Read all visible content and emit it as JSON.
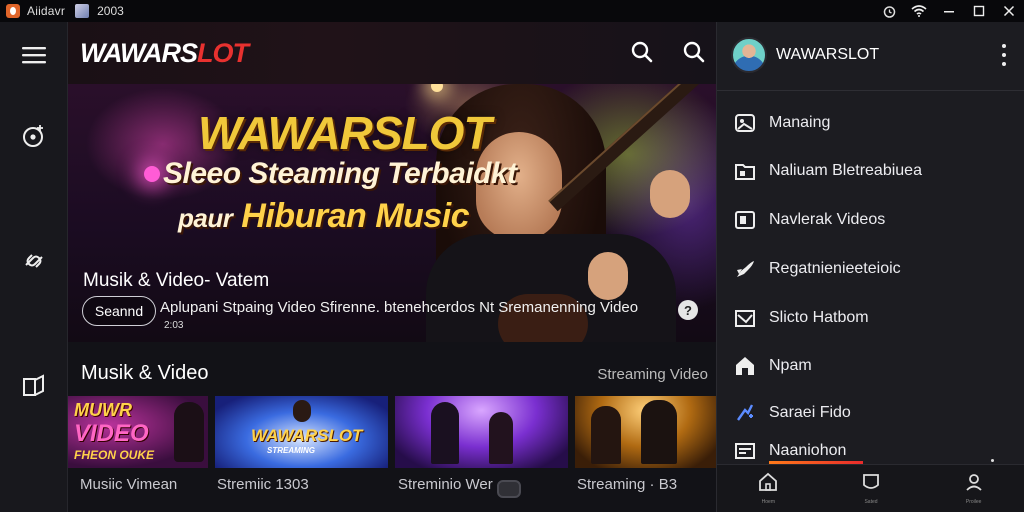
{
  "titlebar": {
    "app_title": "Aiidavr",
    "year": "2003",
    "icons": [
      "app-icon",
      "window-thumbnail",
      "alarm-icon",
      "wifi-icon",
      "minimize-icon",
      "maximize-icon",
      "close-icon"
    ]
  },
  "rail": {
    "items": [
      "menu-icon",
      "music-disc-icon",
      "link-icon",
      "book-icon"
    ]
  },
  "brand": {
    "logo_main": "WAWARS",
    "logo_accent": "LOT",
    "accent_color": "#e8312f"
  },
  "hero": {
    "title": "WAWARSLOT",
    "line2": "Sleeo Steaming Terbaidkt",
    "line3_prefix": "paur",
    "line3_main": "Hiburan Music",
    "subtitle": "Musik & Video- Vatem",
    "button_label": "Seannd",
    "description": "Aplupani Stpaing Video Sfirenne. btenehcerdos  Nt Sremanenning Video",
    "count": "2:03",
    "info_glyph": "?"
  },
  "section": {
    "title": "Musik & Video",
    "more_label": "Streaming Video"
  },
  "thumbnails": [
    {
      "label_line1": "MUWR",
      "label_line2": "VIDEO",
      "label_line3": "FHEON OUKE",
      "caption": "Musiic Vimean"
    },
    {
      "label_line1": "WAWARSLOT",
      "label_line2": "STREAMING",
      "caption": "Stremiic 1303"
    },
    {
      "caption": "Streminio Wer"
    },
    {
      "caption": "Streaming · B3"
    }
  ],
  "panel": {
    "user_name": "WAWARSLOT",
    "menu": [
      {
        "icon": "photo-icon",
        "label": "Manaing"
      },
      {
        "icon": "folder-icon",
        "label": "Naliuam Bletreabiuea"
      },
      {
        "icon": "video-icon",
        "label": "Navlerak Videos"
      },
      {
        "icon": "rocket-icon",
        "label": "Regatnienieeteioic"
      },
      {
        "icon": "image-icon",
        "label": "Slicto Hatbom"
      },
      {
        "icon": "home-icon",
        "label": "Npam"
      },
      {
        "icon": "spark-icon",
        "label": "Saraei Fido"
      },
      {
        "icon": "settings-icon",
        "label": "Naaniohon"
      }
    ],
    "bottom_nav": [
      {
        "icon": "home-icon",
        "label": "Hoem"
      },
      {
        "icon": "shield-icon",
        "label": "Sated"
      },
      {
        "icon": "profile-icon",
        "label": "Proilee"
      }
    ]
  }
}
